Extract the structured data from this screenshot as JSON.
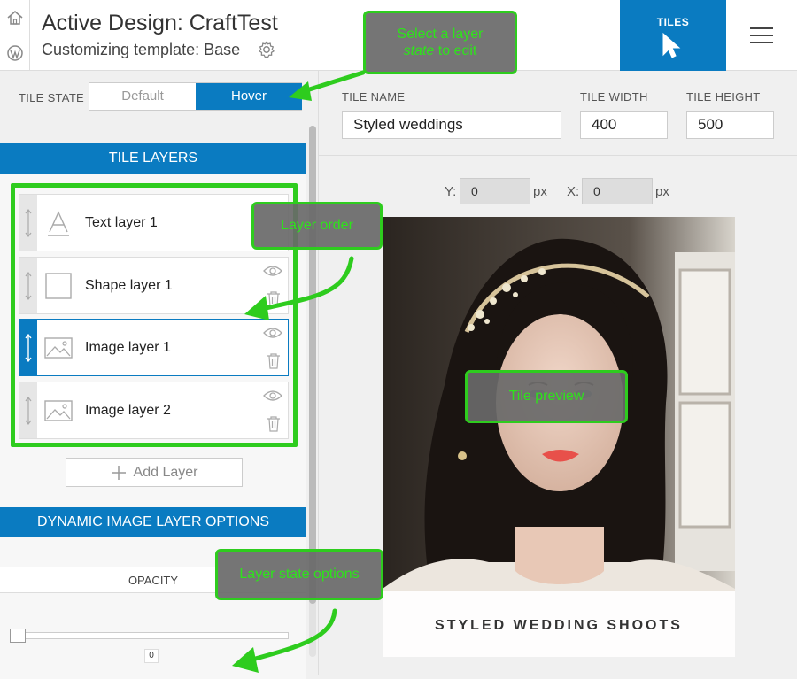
{
  "header": {
    "title": "Active Design: CraftTest",
    "subtitle": "Customizing template: Base",
    "tiles_label": "TILES"
  },
  "left_panel": {
    "tile_state_label": "TILE STATE",
    "state_options": [
      "Default",
      "Hover"
    ],
    "selected_state": "Hover",
    "tile_layers_heading": "TILE LAYERS",
    "layers": [
      {
        "name": "Text layer 1",
        "type": "text"
      },
      {
        "name": "Shape layer 1",
        "type": "shape"
      },
      {
        "name": "Image layer 1",
        "type": "image",
        "selected": true
      },
      {
        "name": "Image layer 2",
        "type": "image"
      }
    ],
    "add_layer_label": "Add Layer",
    "dynamic_heading": "DYNAMIC IMAGE LAYER OPTIONS",
    "opacity_label": "OPACITY",
    "opacity_value": "0"
  },
  "tile_settings": {
    "name_label": "TILE NAME",
    "name_value": "Styled weddings",
    "width_label": "TILE WIDTH",
    "width_value": "400",
    "height_label": "TILE HEIGHT",
    "height_value": "500",
    "y_label": "Y:",
    "y_value": "0",
    "x_label": "X:",
    "x_value": "0",
    "px_unit": "px"
  },
  "preview": {
    "caption": "STYLED WEDDING SHOOTS"
  },
  "callouts": {
    "state_pre": "Select a layer",
    "state_em": "state",
    "state_post": "to edit",
    "order": "Layer order",
    "preview": "Tile preview",
    "options": "Layer state options"
  },
  "colors": {
    "accent": "#0a7bc1",
    "callout_border": "#2ecc1e",
    "callout_text": "#2ee31b"
  }
}
